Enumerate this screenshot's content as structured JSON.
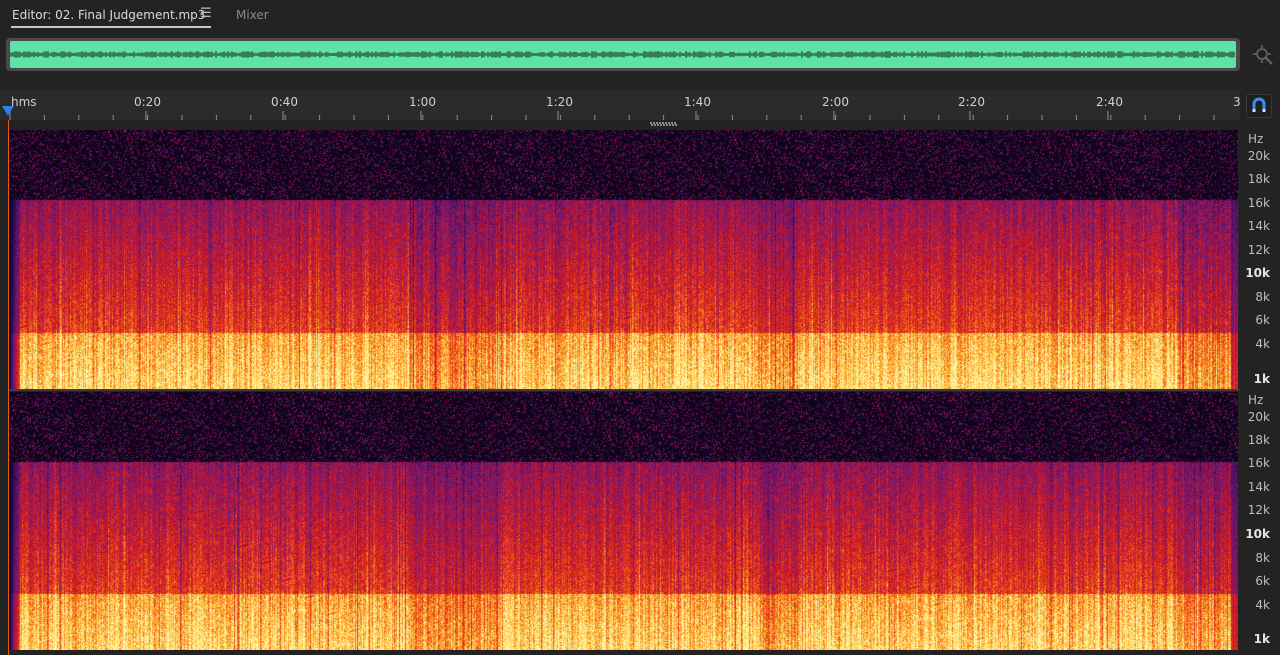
{
  "tabs": {
    "editor_label": "Editor: 02. Final Judgement.mp3",
    "menu_icon": "☰",
    "mixer_label": "Mixer"
  },
  "overview": {
    "waveform_color": "#5ee2a6",
    "zoom_icon": "zoom-navigator-icon"
  },
  "ruler": {
    "unit_label": "hms",
    "ticks": [
      "0:20",
      "0:40",
      "1:00",
      "1:20",
      "1:40",
      "2:00",
      "2:20",
      "2:40"
    ],
    "end_label": "3",
    "snap_icon": "magnet-icon",
    "playhead_color": "#2f7fe4"
  },
  "frequency_scale": {
    "unit": "Hz",
    "labels": [
      "20k",
      "18k",
      "16k",
      "14k",
      "12k",
      "10k",
      "8k",
      "6k",
      "4k",
      "1k"
    ],
    "emphasized": [
      "10k",
      "1k"
    ]
  },
  "spectrogram": {
    "channels": 2,
    "palette": [
      "#000000",
      "#3a1060",
      "#7a1a80",
      "#c01830",
      "#e8301a",
      "#f57a18",
      "#ffd84a",
      "#fff2a0"
    ]
  }
}
